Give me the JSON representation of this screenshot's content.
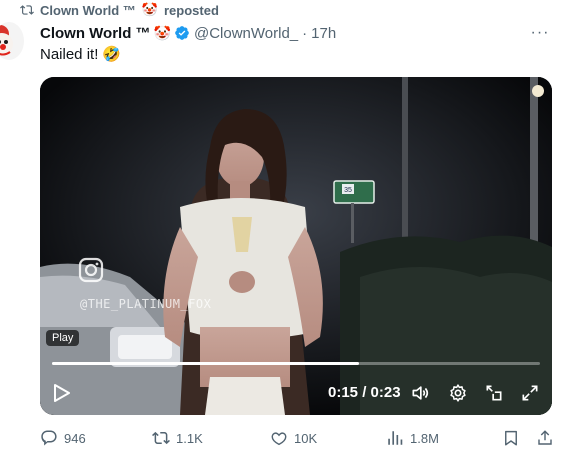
{
  "repost": {
    "name": "Clown World ™",
    "emoji": "🤡",
    "label": "reposted"
  },
  "tweet": {
    "display_name": "Clown World ™",
    "emoji": "🤡",
    "handle": "@ClownWorld_",
    "separator": "·",
    "time": "17h",
    "more_label": "···",
    "text": "Nailed it!",
    "text_emoji": "🤣",
    "verified_color": "#1d9bf0"
  },
  "video": {
    "watermark": "@THE_PLATINUM_FOX",
    "play_badge": "Play",
    "time_readout": "0:15 / 0:23",
    "progress_fraction": 0.63,
    "sign_number": "35"
  },
  "actions": {
    "replies": "946",
    "reposts": "1.1K",
    "likes": "10K",
    "views": "1.8M"
  },
  "icons": {
    "repost": "repost-icon",
    "verified": "verified-badge-icon",
    "reply": "reply-icon",
    "like": "heart-icon",
    "views": "views-chart-icon",
    "bookmark": "bookmark-icon",
    "share": "share-icon",
    "play": "play-icon",
    "volume": "volume-icon",
    "settings": "gear-icon",
    "pip": "picture-in-picture-icon",
    "fullscreen": "fullscreen-icon",
    "instagram": "instagram-icon"
  }
}
